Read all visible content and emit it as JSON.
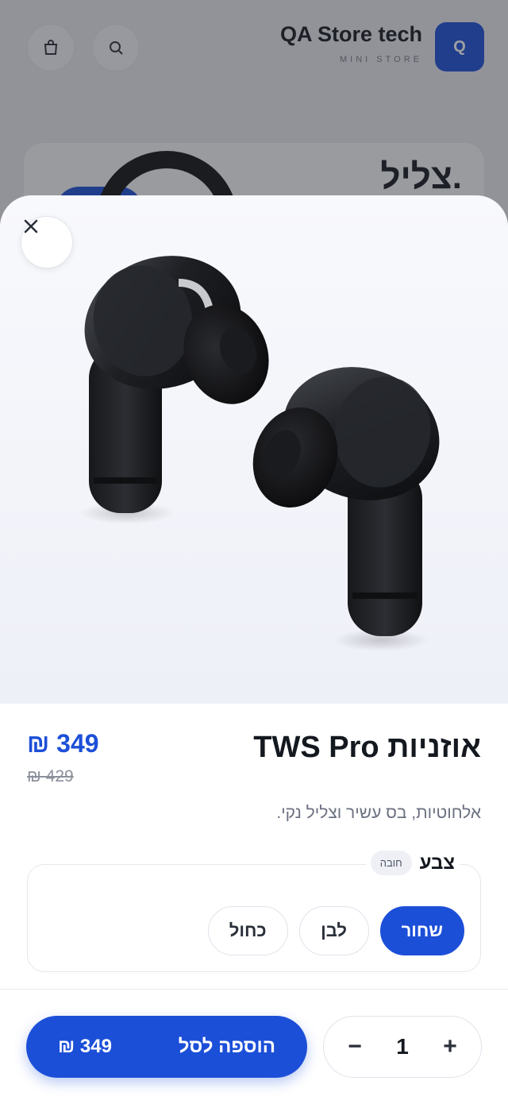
{
  "store": {
    "name": "QA Store tech",
    "subtitle": "MINI STORE",
    "logo_letter": "Q",
    "hero_text": "צליל."
  },
  "product": {
    "title": "אוזניות TWS Pro",
    "price": "349 ₪",
    "old_price": "429 ₪",
    "description": "אלחוטיות, בס עשיר וצליל נקי.",
    "image_alt": "black wireless earbuds"
  },
  "options": {
    "label": "צבע",
    "badge": "חובה",
    "choices": [
      "שחור",
      "לבן",
      "כחול"
    ],
    "selected": "שחור"
  },
  "cart": {
    "quantity": "1",
    "minus": "−",
    "plus": "+",
    "add_label": "הוספה לסל",
    "add_price": "349 ₪"
  },
  "colors": {
    "accent": "#1c4fd8",
    "text": "#14181f",
    "muted": "#6b7180"
  }
}
